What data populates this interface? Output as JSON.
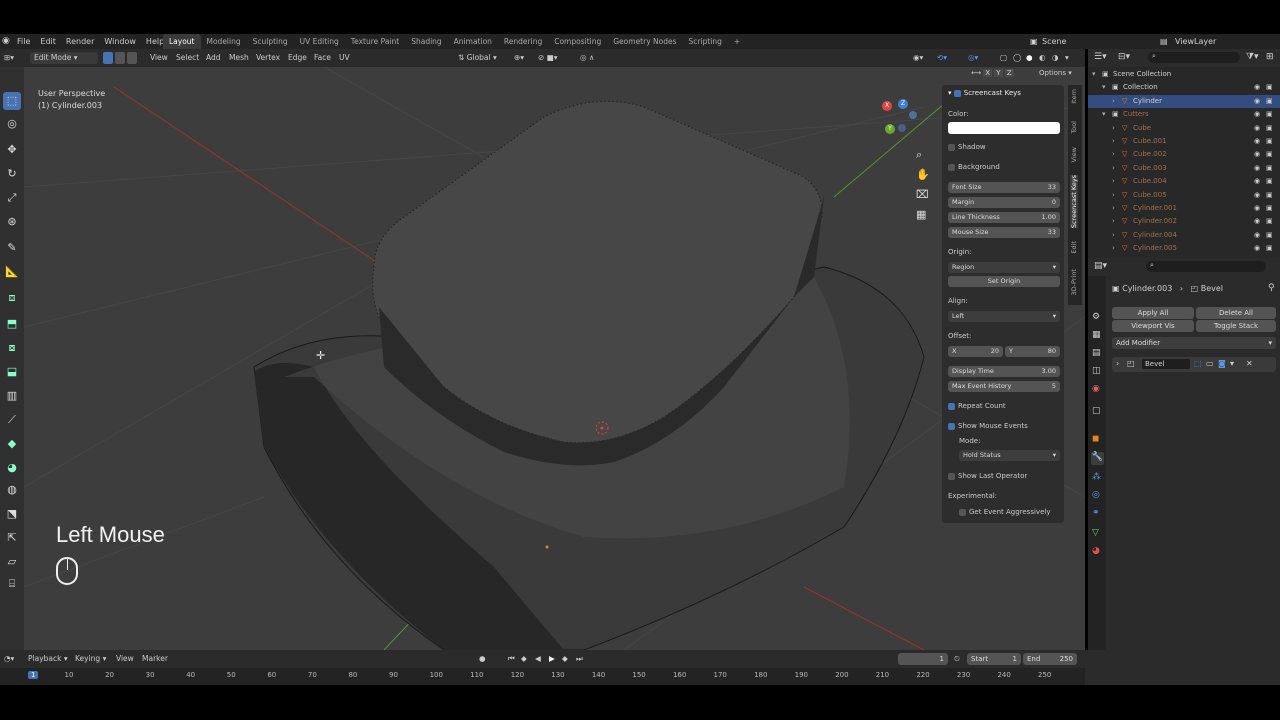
{
  "menu": [
    "File",
    "Edit",
    "Render",
    "Window",
    "Help"
  ],
  "workspaces": [
    "Layout",
    "Modeling",
    "Sculpting",
    "UV Editing",
    "Texture Paint",
    "Shading",
    "Animation",
    "Rendering",
    "Compositing",
    "Geometry Nodes",
    "Scripting",
    "+"
  ],
  "scene_label": "Scene",
  "view_layer_label": "ViewLayer",
  "header": {
    "mode": "Edit Mode",
    "menus": [
      "View",
      "Select",
      "Add",
      "Mesh",
      "Vertex",
      "Edge",
      "Face",
      "UV"
    ],
    "orientation": "Global",
    "options": "Options",
    "axes": [
      "X",
      "Y",
      "Z"
    ]
  },
  "viewport": {
    "perspective": "User Perspective",
    "object": "(1) Cylinder.003",
    "screencast_text": "Left Mouse",
    "gizmo_labels": [
      "X",
      "Y",
      "Z"
    ]
  },
  "npanel": {
    "title": "Screencast Keys",
    "color_label": "Color:",
    "color_value": "#ffffff",
    "shadow": "Shadow",
    "background": "Background",
    "font_size_label": "Font Size",
    "font_size": "33",
    "margin_label": "Margin",
    "margin": "0",
    "line_thickness_label": "Line Thickness",
    "line_thickness": "1.00",
    "mouse_size_label": "Mouse Size",
    "mouse_size": "33",
    "origin_label": "Origin:",
    "origin_value": "Region",
    "set_origin": "Set Origin",
    "align_label": "Align:",
    "align_value": "Left",
    "offset_label": "Offset:",
    "offset_x_label": "X",
    "offset_x": "20",
    "offset_y_label": "Y",
    "offset_y": "80",
    "display_time_label": "Display Time",
    "display_time": "3.00",
    "max_event_label": "Max Event History",
    "max_event": "5",
    "repeat_count": "Repeat Count",
    "show_mouse_events": "Show Mouse Events",
    "mode_label": "Mode:",
    "mode_value": "Hold Status",
    "show_last_operator": "Show Last Operator",
    "experimental_label": "Experimental:",
    "get_event": "Get Event Aggressively"
  },
  "vertical_tabs": [
    "Item",
    "Tool",
    "View",
    "Screencast Keys",
    "Edit",
    "3D-Print"
  ],
  "outliner": {
    "items": [
      {
        "name": "Scene Collection",
        "indent": 0
      },
      {
        "name": "Collection",
        "indent": 1
      },
      {
        "name": "Cylinder",
        "indent": 2
      },
      {
        "name": "Cutters",
        "indent": 1
      },
      {
        "name": "Cube",
        "indent": 2
      },
      {
        "name": "Cube.001",
        "indent": 2
      },
      {
        "name": "Cube.002",
        "indent": 2
      },
      {
        "name": "Cube.003",
        "indent": 2
      },
      {
        "name": "Cube.004",
        "indent": 2
      },
      {
        "name": "Cube.005",
        "indent": 2
      },
      {
        "name": "Cylinder.001",
        "indent": 2
      },
      {
        "name": "Cylinder.002",
        "indent": 2
      },
      {
        "name": "Cylinder.004",
        "indent": 2
      },
      {
        "name": "Cylinder.005",
        "indent": 2
      }
    ]
  },
  "properties": {
    "object": "Cylinder.003",
    "modifier": "Bevel",
    "apply_all": "Apply All",
    "delete_all": "Delete All",
    "viewport_vis": "Viewport Vis",
    "toggle_stack": "Toggle Stack",
    "add_modifier": "Add Modifier",
    "modifier_name": "Bevel"
  },
  "timeline": {
    "menus": [
      "Playback",
      "Keying",
      "View",
      "Marker"
    ],
    "current_frame": "1",
    "start_label": "Start",
    "start": "1",
    "end_label": "End",
    "end": "250",
    "ruler": [
      "1",
      "10",
      "20",
      "30",
      "40",
      "50",
      "60",
      "70",
      "80",
      "90",
      "100",
      "110",
      "120",
      "130",
      "140",
      "150",
      "160",
      "170",
      "180",
      "190",
      "200",
      "210",
      "220",
      "230",
      "240",
      "250"
    ]
  },
  "colors": {
    "accent": "#4772b3",
    "active_orange": "#e8821e",
    "outliner_cutters": "#c08040"
  }
}
